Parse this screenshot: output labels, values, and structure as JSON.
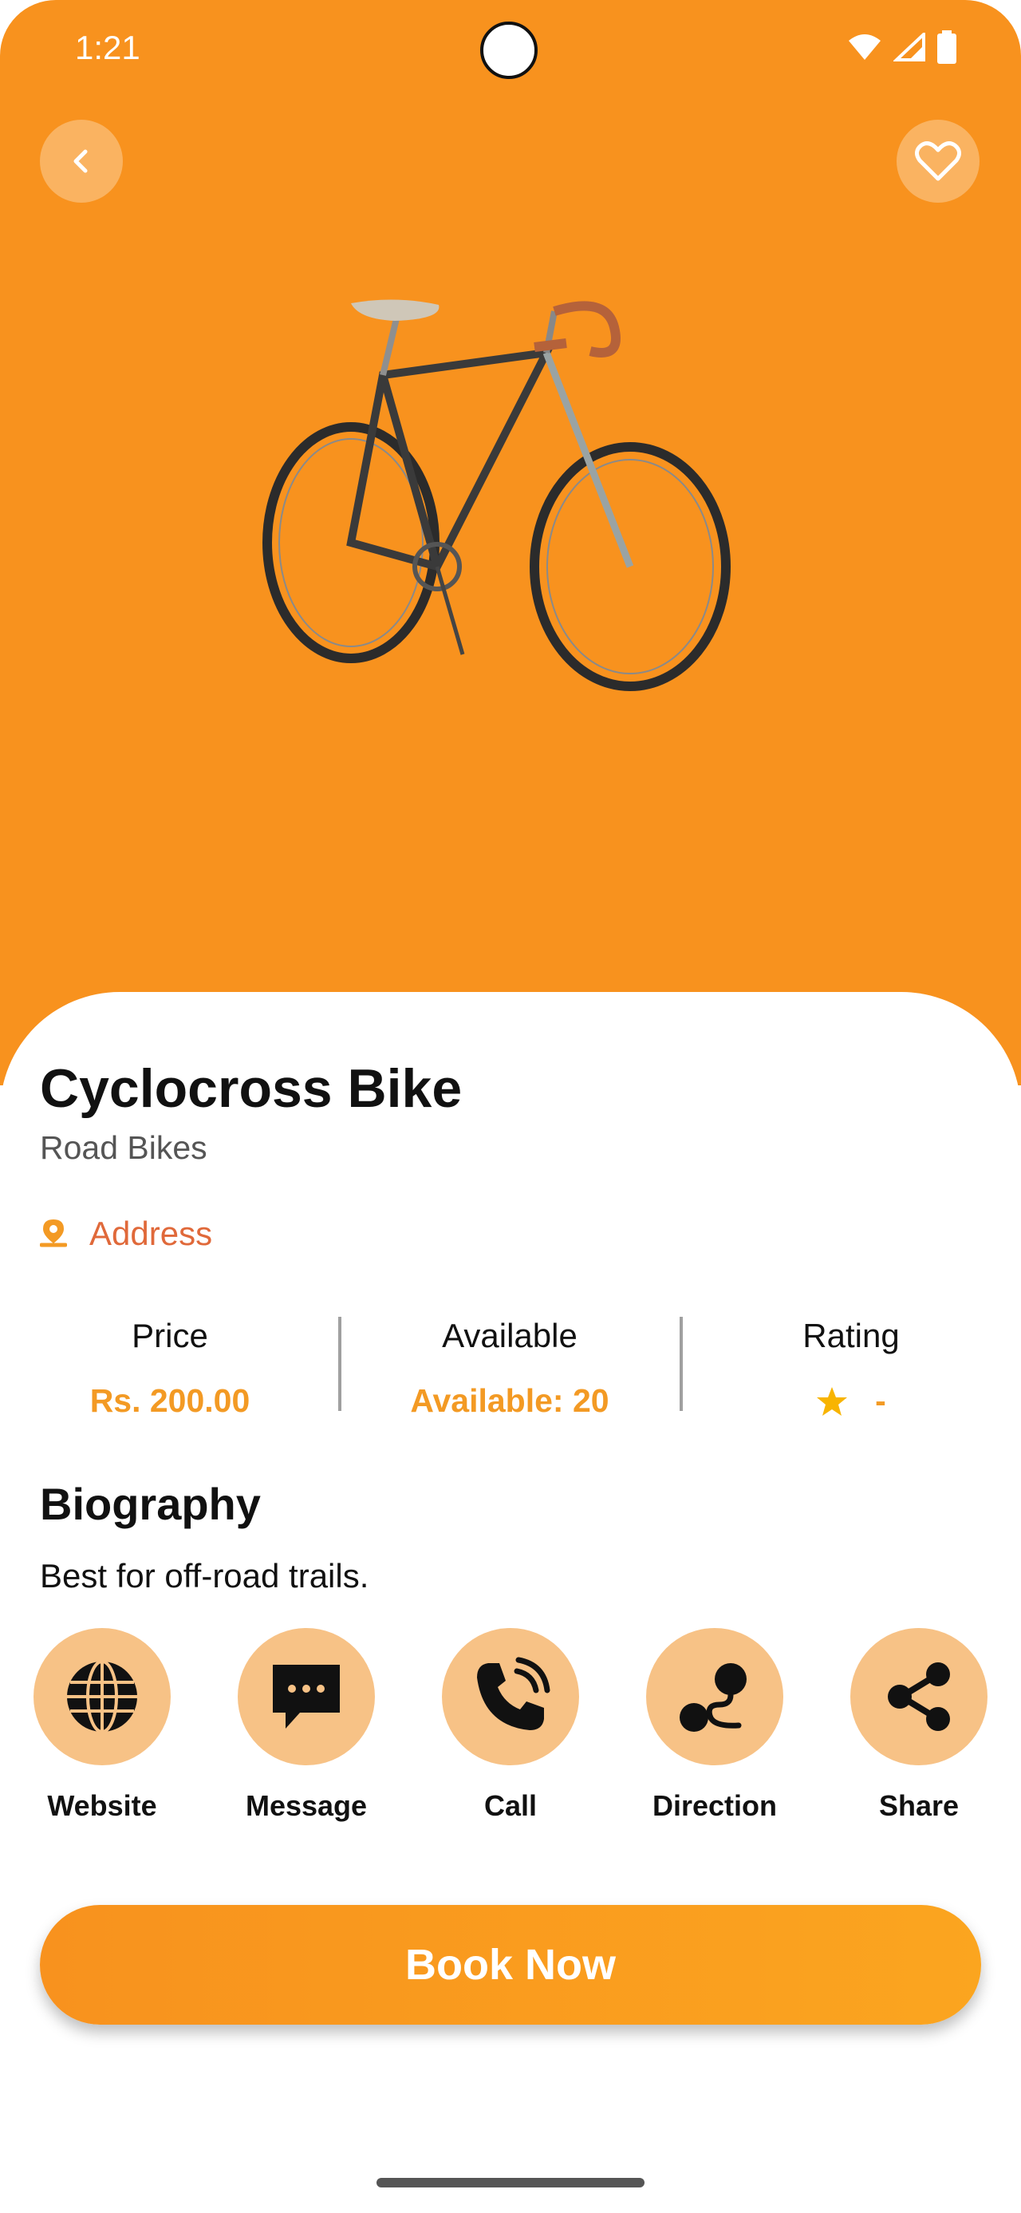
{
  "status_bar": {
    "time": "1:21"
  },
  "product": {
    "title": "Cyclocross Bike",
    "category": "Road Bikes",
    "address_label": "Address"
  },
  "stats": [
    {
      "label": "Price",
      "value": "Rs. 200.00"
    },
    {
      "label": "Available",
      "value": "Available: 20"
    },
    {
      "label": "Rating",
      "value": "-"
    }
  ],
  "biography": {
    "title": "Biography",
    "text": "Best for off-road trails."
  },
  "actions": [
    {
      "label": "Website",
      "icon": "globe-icon"
    },
    {
      "label": "Message",
      "icon": "message-icon"
    },
    {
      "label": "Call",
      "icon": "phone-icon"
    },
    {
      "label": "Direction",
      "icon": "route-icon"
    },
    {
      "label": "Share",
      "icon": "share-icon"
    }
  ],
  "book_button": {
    "label": "Book Now"
  },
  "colors": {
    "hero": "#F8921E",
    "accent": "#F39A24",
    "action_bg": "#F7C286",
    "address": "#E0693A"
  }
}
